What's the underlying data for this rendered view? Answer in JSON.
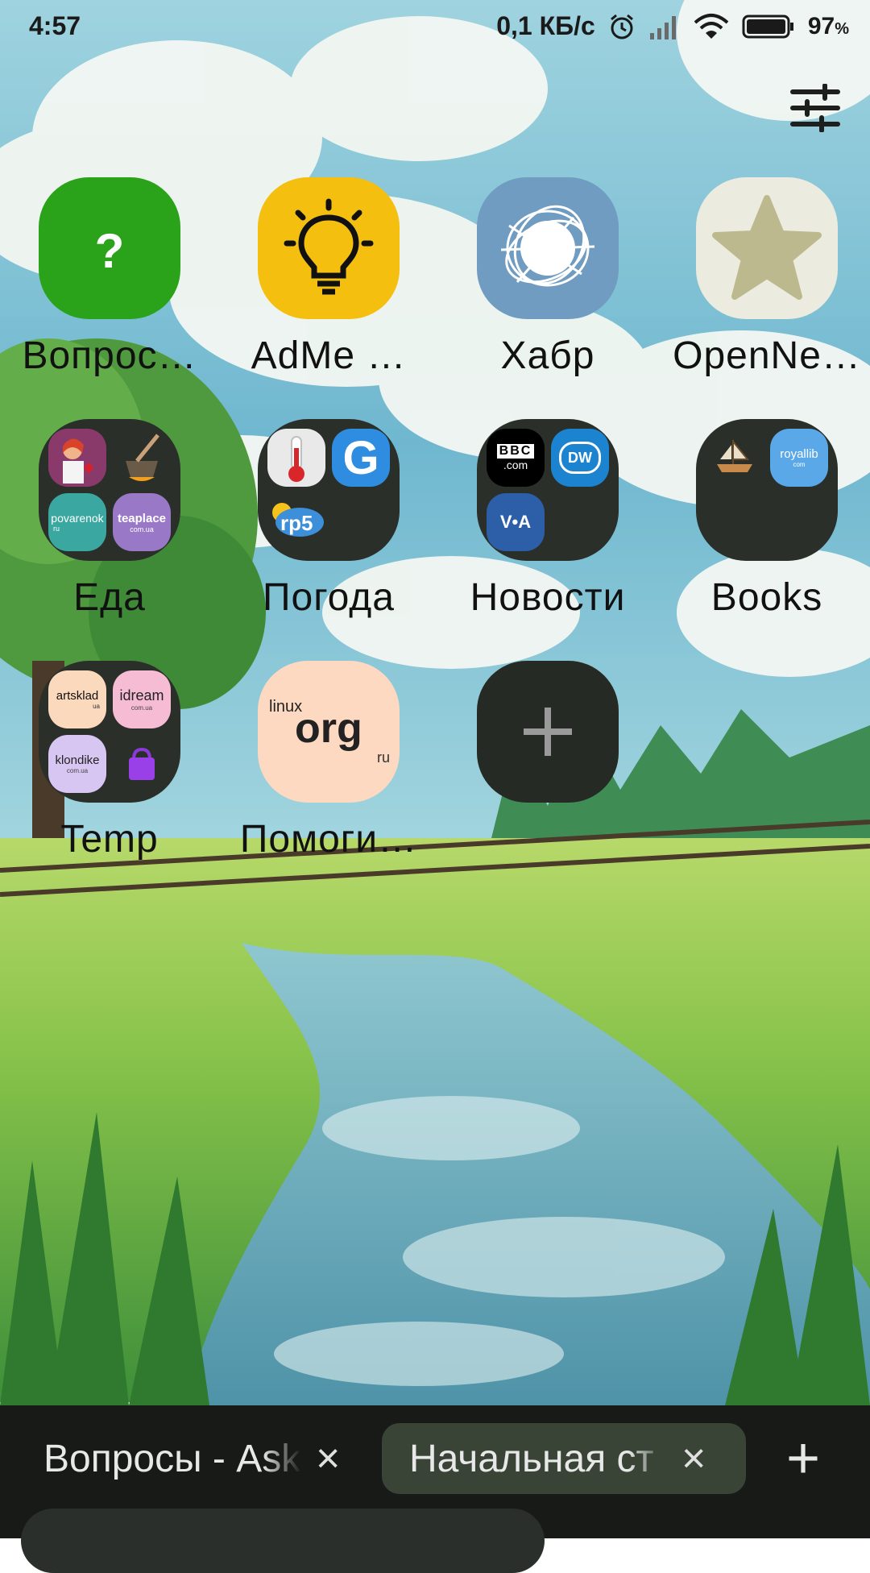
{
  "status": {
    "time": "4:57",
    "net_speed": "0,1 КБ/с",
    "battery": "97",
    "battery_unit": "%"
  },
  "colors": {
    "sky": "#7ec4d8",
    "grass": "#8fc44a",
    "tabbar": "#171a17",
    "active_tab": "#3a4436",
    "folder": "#2b2f2a"
  },
  "tiles": [
    {
      "label": "Вопрос…",
      "icon": "question-icon",
      "color": "#2aa31a"
    },
    {
      "label": "AdMe …",
      "icon": "lightbulb-icon",
      "color": "#f5bf0f"
    },
    {
      "label": "Хабр",
      "icon": "habr-scribble-icon",
      "color": "#6f9cc0"
    },
    {
      "label": "OpenNe…",
      "icon": "star-icon",
      "color": "#ecebdf"
    },
    {
      "label": "Еда",
      "icon": "folder"
    },
    {
      "label": "Погода",
      "icon": "folder"
    },
    {
      "label": "Новости",
      "icon": "folder"
    },
    {
      "label": "Books",
      "icon": "folder"
    },
    {
      "label": "Temp",
      "icon": "folder"
    },
    {
      "label": "Помоги…",
      "icon": "linux-org-icon",
      "color": "#fcd9c0"
    },
    {
      "label": "",
      "icon": "plus-icon",
      "color": "#262a25"
    }
  ],
  "folder_minis": {
    "eda": {
      "povarenok": "povarenok",
      "povarenok_sub": "ru",
      "teaplace": "teaplace",
      "teaplace_sub": "com.ua"
    },
    "pogoda": {
      "g": "G",
      "rp5": "rp5"
    },
    "novosti": {
      "bbc": "BBC",
      "bbc_sub": ".com",
      "dw": "DW",
      "voa": "V•A"
    },
    "books": {
      "royallib": "royallib",
      "royallib_sub": "com"
    },
    "temp": {
      "artsklad": "artsklad",
      "artsklad_sub": "ua",
      "idream": "idream",
      "idream_sub": "com.ua",
      "klondike": "klondike",
      "klondike_sub": "com.ua"
    }
  },
  "linux_org": {
    "top": "linux",
    "main": "org",
    "sub": "ru"
  },
  "tabs": [
    {
      "title": "Вопросы - Ask",
      "close": "×"
    },
    {
      "title": "Начальная ст",
      "close": "×"
    }
  ],
  "new_tab": "+"
}
